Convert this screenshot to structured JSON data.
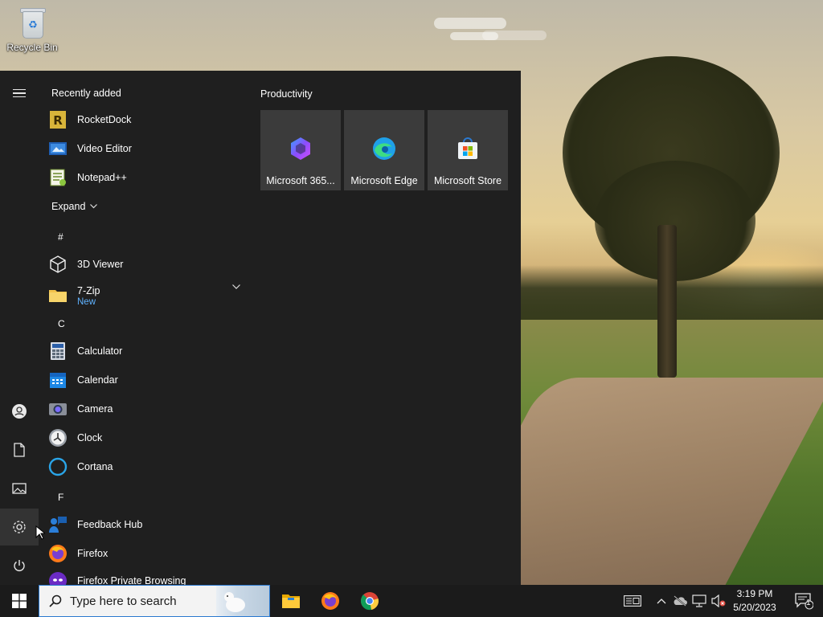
{
  "desktop": {
    "icons": [
      {
        "label": "Recycle Bin",
        "icon": "recycle-bin-icon"
      }
    ]
  },
  "start_menu": {
    "rail": [
      "hamburger-menu-icon",
      "user-account-icon",
      "documents-icon",
      "pictures-icon",
      "settings-icon",
      "power-icon"
    ],
    "recently_added_header": "Recently added",
    "recent_items": [
      {
        "label": "RocketDock",
        "icon": "rocketdock-icon"
      },
      {
        "label": "Video Editor",
        "icon": "video-editor-icon"
      },
      {
        "label": "Notepad++",
        "icon": "notepadpp-icon"
      }
    ],
    "expand_label": "Expand",
    "groups": {
      "hash": "#",
      "c": "C",
      "f": "F"
    },
    "apps": {
      "viewer3d": "3D Viewer",
      "zip7": "7-Zip",
      "zip7_badge": "New",
      "calculator": "Calculator",
      "calendar": "Calendar",
      "camera": "Camera",
      "clock": "Clock",
      "cortana": "Cortana",
      "feedback_hub": "Feedback Hub",
      "firefox": "Firefox",
      "firefox_private": "Firefox Private Browsing"
    },
    "tiles_header": "Productivity",
    "tiles": [
      {
        "label": "Microsoft 365...",
        "icon": "microsoft-365-icon"
      },
      {
        "label": "Microsoft Edge",
        "icon": "edge-icon"
      },
      {
        "label": "Microsoft Store",
        "icon": "store-icon"
      }
    ]
  },
  "taskbar": {
    "search_placeholder": "Type here to search",
    "pinned": [
      "file-explorer-icon",
      "firefox-icon",
      "chrome-icon"
    ],
    "tray_icons": [
      "news-icon",
      "chevron-up-icon",
      "onedrive-icon",
      "network-icon",
      "volume-muted-icon"
    ],
    "time": "3:19 PM",
    "date": "5/20/2023",
    "notification_count": "1"
  },
  "colors": {
    "start_bg": "#1f1f1f",
    "tile_bg": "#3b3b3b",
    "accent": "#2b79d0",
    "badge_new": "#5fb2ff",
    "taskbar_bg": "#1b1b1b"
  }
}
